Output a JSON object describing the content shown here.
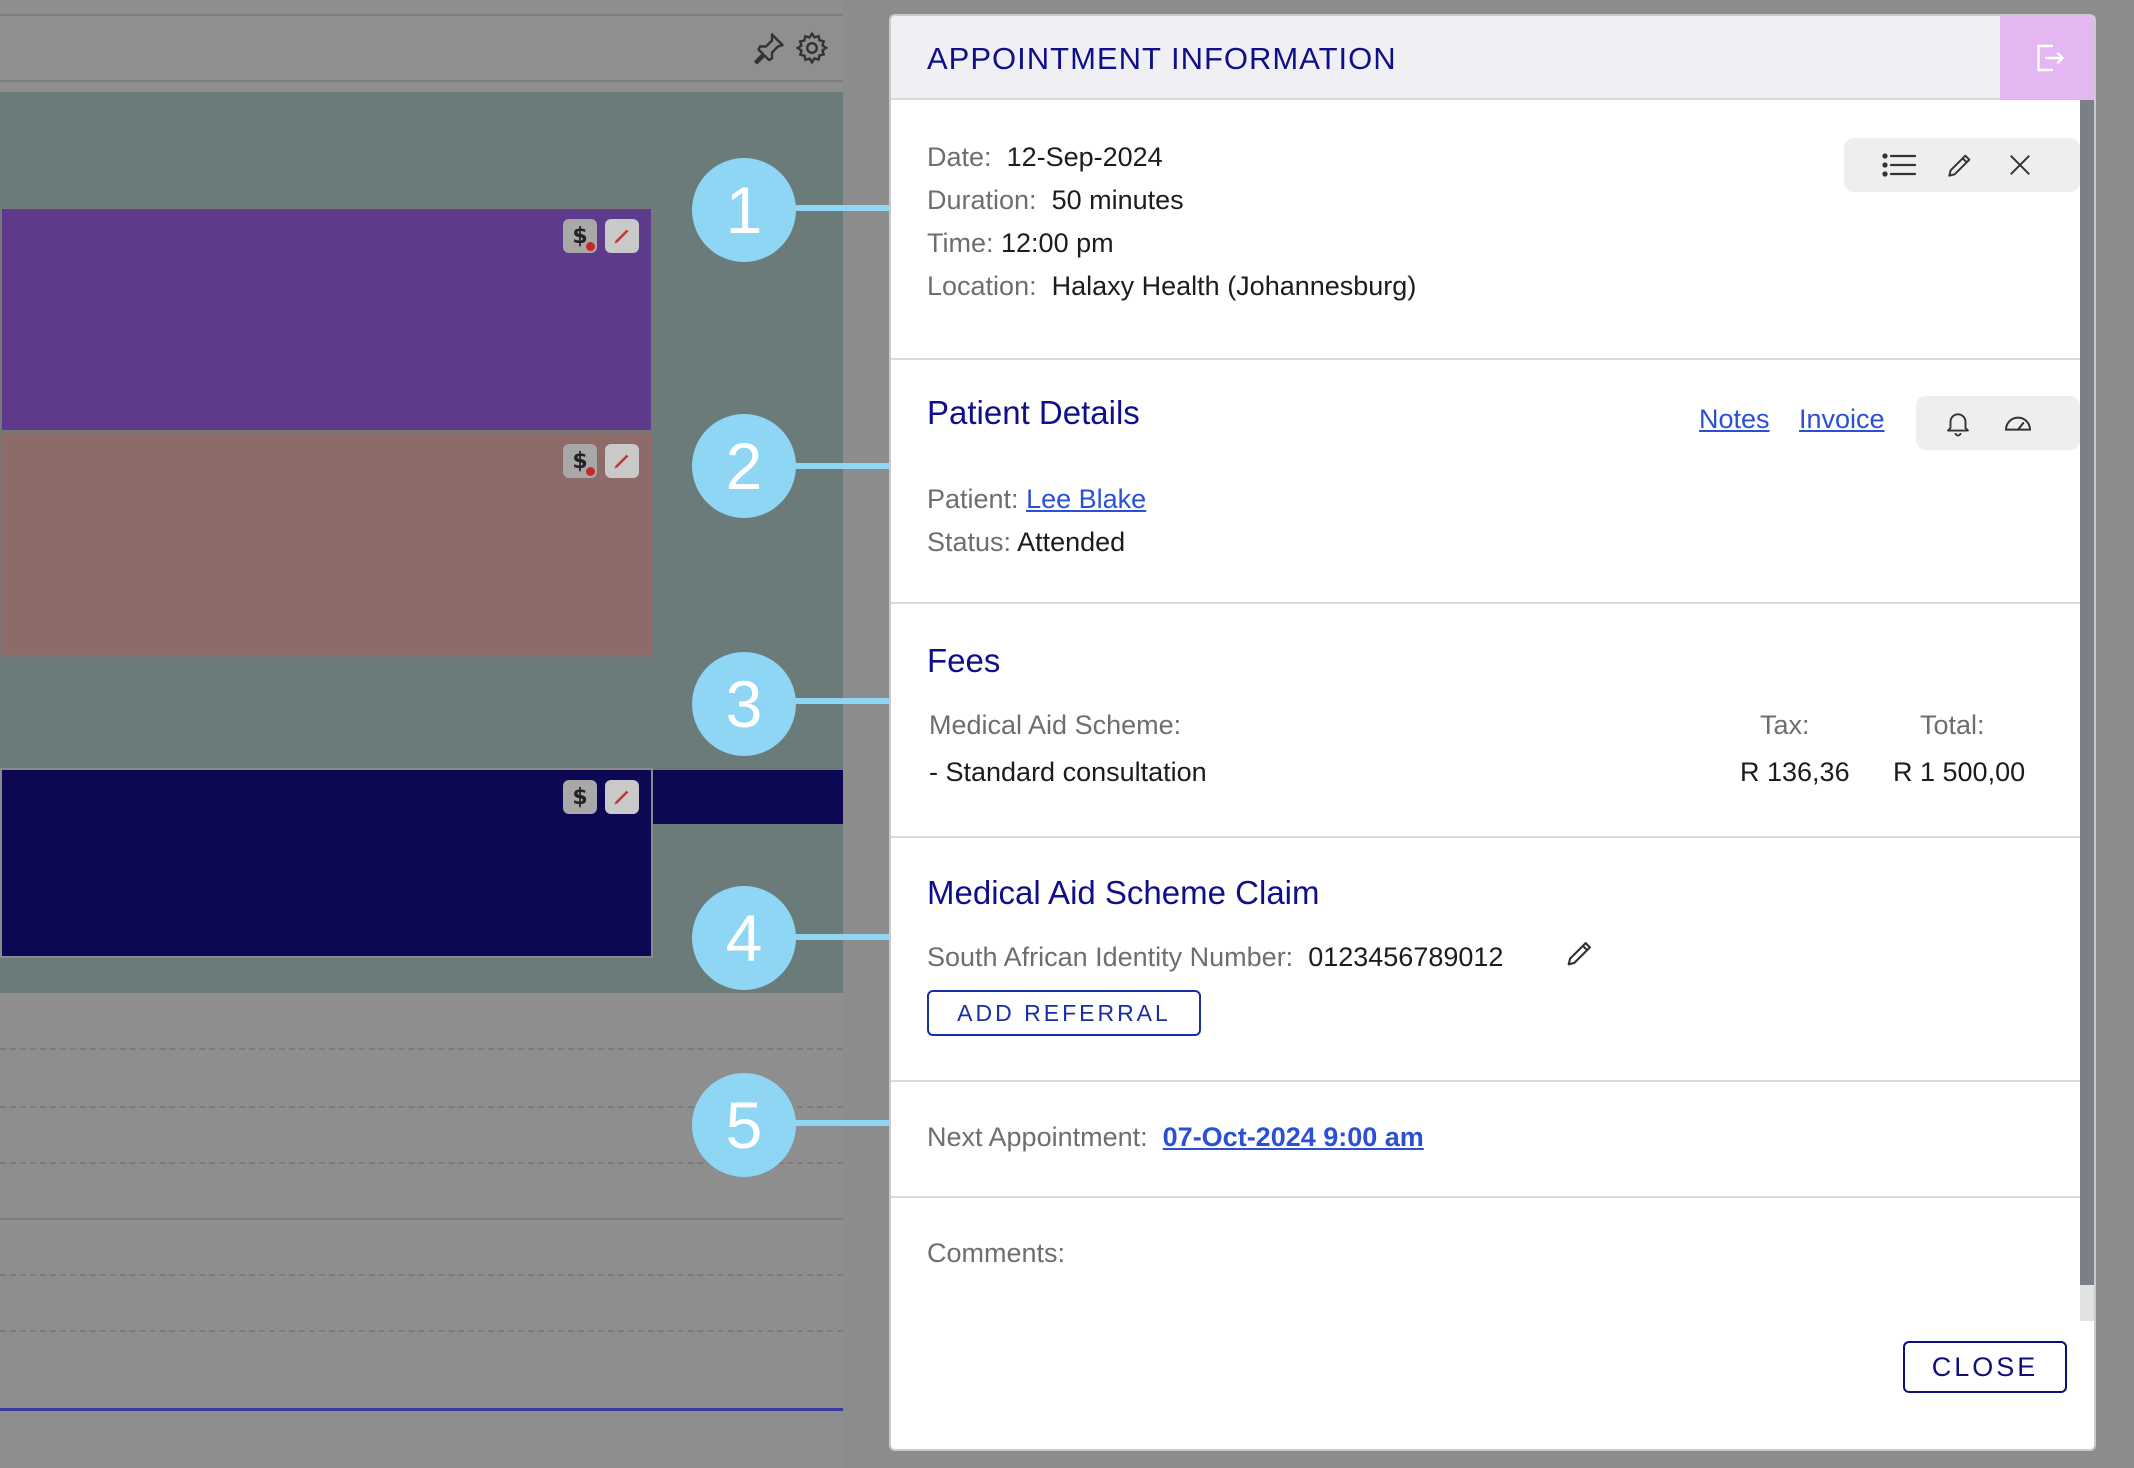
{
  "colors": {
    "accent": "#0f0f8a",
    "link": "#2b50d6",
    "callout": "#8fd6f5",
    "exit_button": "#e4b7f2",
    "appointment_purple": "#5e3a8c",
    "appointment_rose": "#8e6a68",
    "appointment_navy": "#0c0854"
  },
  "background": {
    "toolbar_icons": [
      "pin-icon",
      "gear-icon"
    ],
    "appointment_chips": {
      "fee": "$",
      "edit": "pencil-icon"
    }
  },
  "callouts": [
    "1",
    "2",
    "3",
    "4",
    "5"
  ],
  "modal": {
    "title": "APPOINTMENT INFORMATION",
    "exit_icon": "logout-icon",
    "appointment": {
      "date_label": "Date:",
      "date_value": "12-Sep-2024",
      "duration_label": "Duration:",
      "duration_value": "50 minutes",
      "time_label": "Time:",
      "time_value": "12:00 pm",
      "location_label": "Location:",
      "location_value": "Halaxy Health (Johannesburg)",
      "actions": [
        "list-icon",
        "pencil-icon",
        "close-icon"
      ]
    },
    "patient": {
      "heading": "Patient Details",
      "notes_link": "Notes",
      "invoice_link": "Invoice",
      "actions": [
        "bell-icon",
        "gauge-icon"
      ],
      "patient_label": "Patient:",
      "patient_value": "Lee Blake",
      "status_label": "Status:",
      "status_value": "Attended"
    },
    "fees": {
      "heading": "Fees",
      "scheme_label": "Medical Aid Scheme:",
      "tax_header": "Tax:",
      "total_header": "Total:",
      "items": [
        {
          "name": "- Standard consultation",
          "tax": "R 136,36",
          "total": "R 1 500,00"
        }
      ]
    },
    "claim": {
      "heading": "Medical Aid Scheme Claim",
      "id_label": "South African Identity Number:",
      "id_value": "0123456789012",
      "edit_icon": "pencil-icon",
      "add_referral_label": "ADD REFERRAL"
    },
    "next": {
      "label": "Next Appointment:",
      "value": "07-Oct-2024 9:00 am"
    },
    "comments": {
      "label": "Comments:"
    },
    "close_label": "CLOSE"
  }
}
